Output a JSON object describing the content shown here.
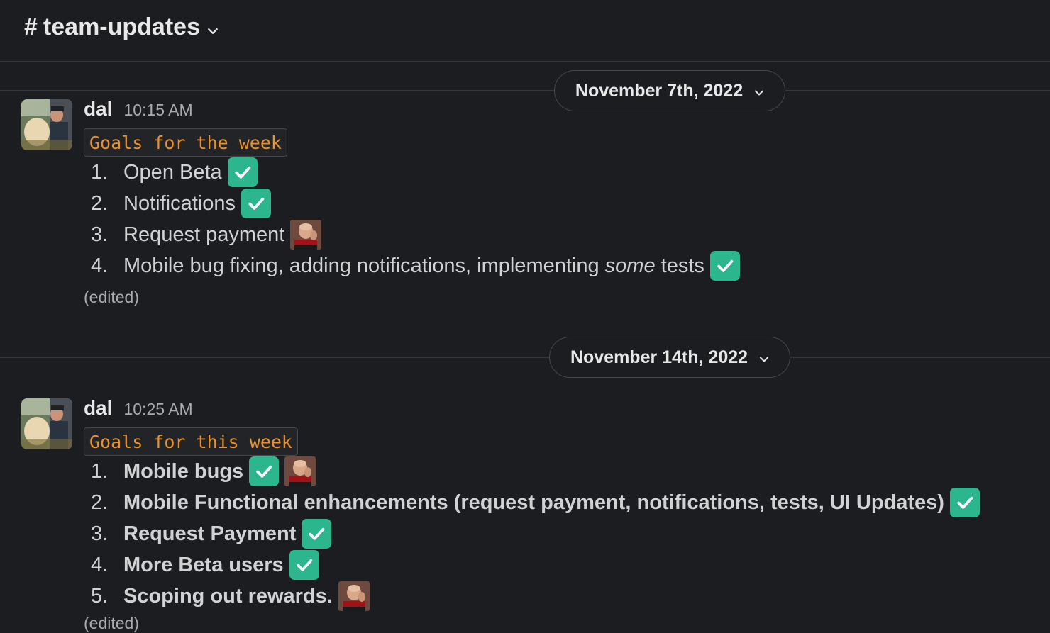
{
  "header": {
    "channel_hash": "#",
    "channel_name": "team-updates"
  },
  "dividers": [
    {
      "label": "November 7th, 2022"
    },
    {
      "label": "November 14th, 2022"
    }
  ],
  "messages": [
    {
      "sender": "dal",
      "time": "10:15 AM",
      "code_label": "Goals for the week",
      "items": [
        {
          "num": "1.",
          "text": "Open Beta",
          "emoji": [
            "white-check-mark"
          ]
        },
        {
          "num": "2.",
          "text": "Notifications",
          "emoji": [
            "white-check-mark"
          ]
        },
        {
          "num": "3.",
          "text": "Request payment",
          "emoji": [
            "picard-facepalm"
          ]
        },
        {
          "num": "4.",
          "text_before": "Mobile bug fixing, adding notifications, implementing ",
          "text_italic": "some",
          "text_after": " tests",
          "emoji": [
            "white-check-mark"
          ]
        }
      ],
      "edited": "(edited)"
    },
    {
      "sender": "dal",
      "time": "10:25 AM",
      "code_label": "Goals for this week",
      "items": [
        {
          "num": "1.",
          "text": "Mobile bugs",
          "emoji": [
            "white-check-mark",
            "picard-facepalm"
          ]
        },
        {
          "num": "2.",
          "text": "Mobile Functional enhancements (request payment, notifications, tests, UI Updates)",
          "emoji": [
            "white-check-mark"
          ]
        },
        {
          "num": "3.",
          "text": "Request Payment",
          "emoji": [
            "white-check-mark"
          ]
        },
        {
          "num": "4.",
          "text": "More Beta users",
          "emoji": [
            "white-check-mark"
          ]
        },
        {
          "num": "5.",
          "text": "Scoping out rewards.",
          "emoji": [
            "picard-facepalm"
          ]
        }
      ],
      "edited": "(edited)"
    }
  ],
  "colors": {
    "background": "#1b1d21",
    "check_emoji": "#2bb68e",
    "code_text": "#e8912d",
    "divider": "#35373b"
  }
}
